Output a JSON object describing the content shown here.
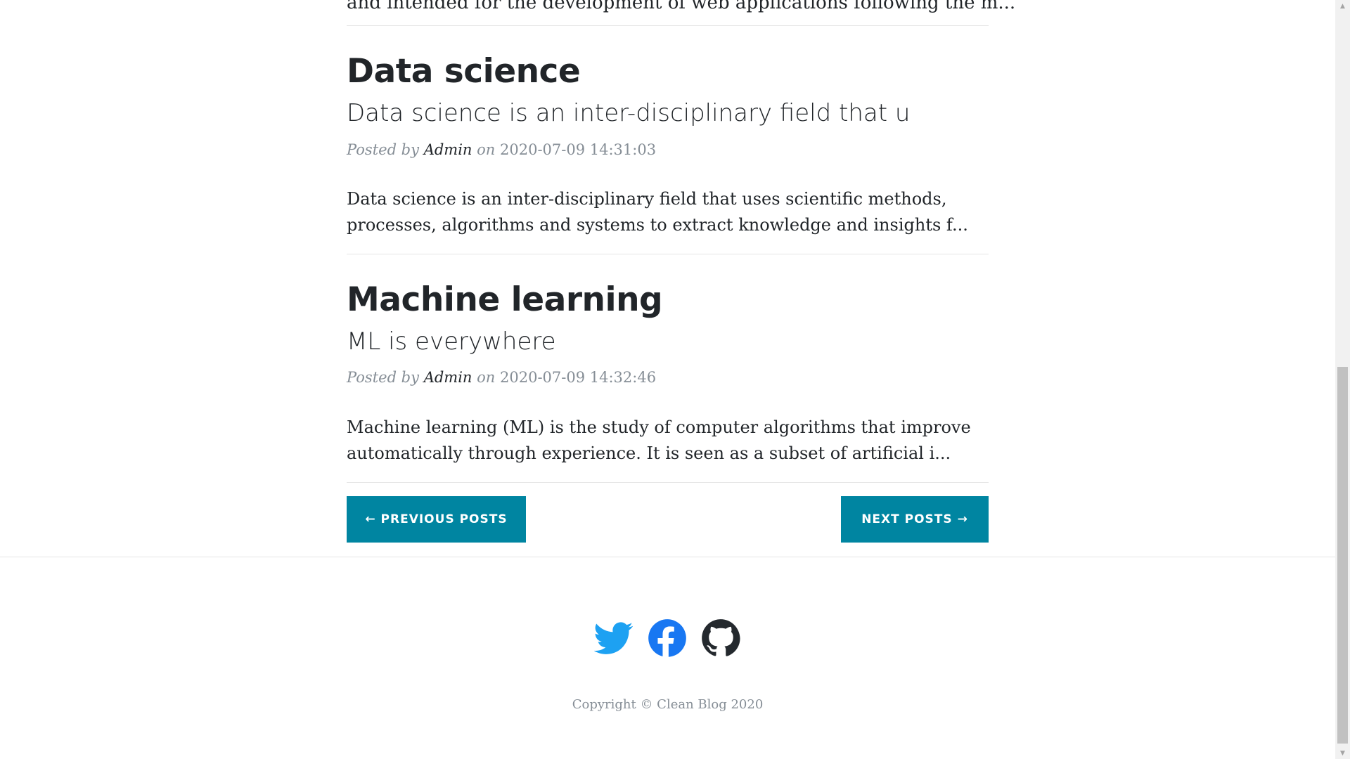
{
  "previous_post": {
    "excerpt_tail": "and intended for the development of web applications following the m..."
  },
  "posts": [
    {
      "title": "Data science",
      "subtitle": "Data science is an inter-disciplinary field that u",
      "meta_prefix": "Posted by",
      "author": "Admin",
      "meta_on": "on",
      "date": "2020-07-09 14:31:03",
      "excerpt": "Data science is an inter-disciplinary field that uses scientific methods, processes, algorithms and systems to extract knowledge and insights f..."
    },
    {
      "title": "Machine learning",
      "subtitle": "ML is everywhere",
      "meta_prefix": "Posted by",
      "author": "Admin",
      "meta_on": "on",
      "date": "2020-07-09 14:32:46",
      "excerpt": "Machine learning (ML) is the study of computer algorithms that improve automatically through experience. It is seen as a subset of artificial i..."
    }
  ],
  "pagination": {
    "previous_label": "← Previous Posts",
    "next_label": "Next Posts →"
  },
  "footer": {
    "social": [
      {
        "name": "twitter-icon",
        "color": "#1da1f2"
      },
      {
        "name": "facebook-icon",
        "color": "#1877f2"
      },
      {
        "name": "github-icon",
        "color": "#24292e"
      }
    ],
    "copyright": "Copyright © Clean Blog 2020"
  },
  "colors": {
    "accent": "#0085a1",
    "text": "#212529",
    "muted": "#868e96"
  }
}
